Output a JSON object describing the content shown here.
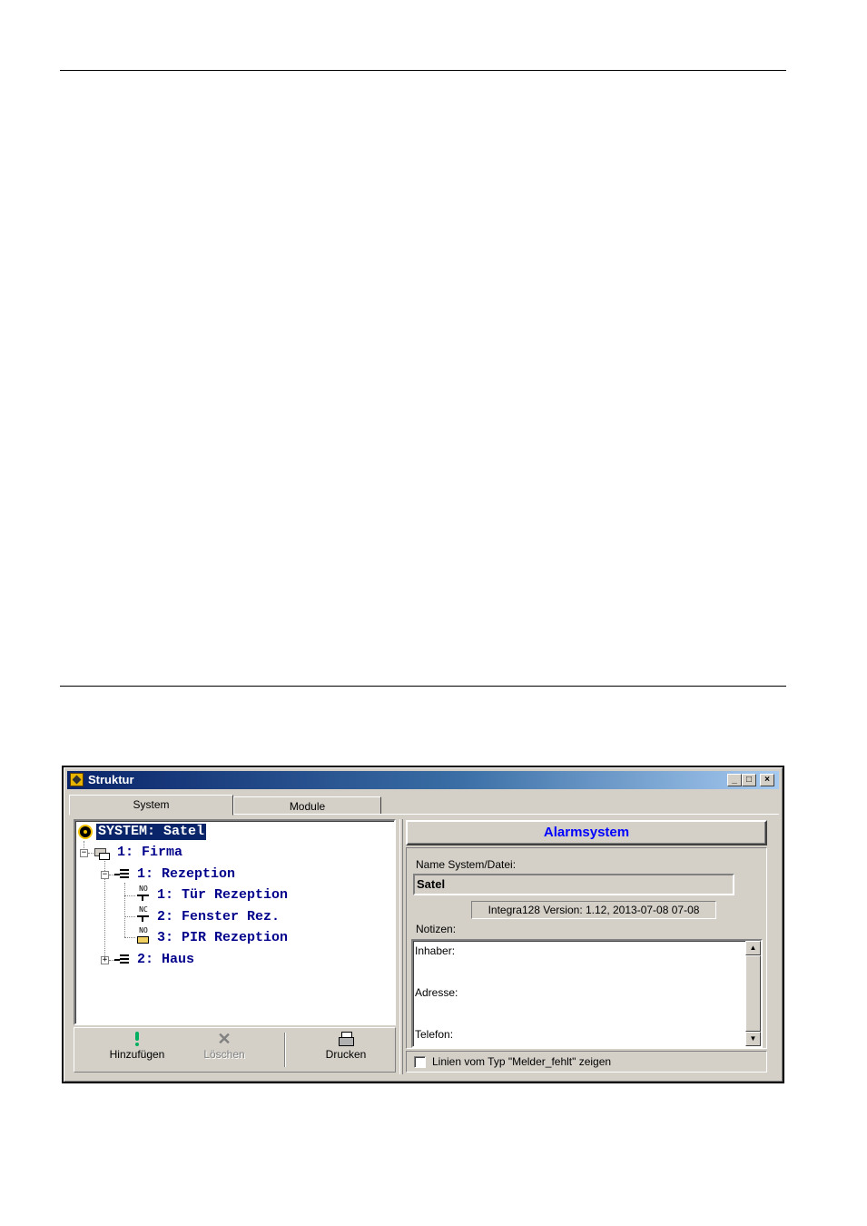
{
  "window": {
    "title": "Struktur"
  },
  "controls": {
    "minimize": "_",
    "maximize": "□",
    "close": "×"
  },
  "tabs": [
    {
      "label": "System",
      "active": true
    },
    {
      "label": "Module",
      "active": false
    }
  ],
  "tree": {
    "root": {
      "label": "SYSTEM: Satel",
      "icon": "system-icon"
    },
    "nodes": [
      {
        "label": "1: Firma",
        "icon": "object-icon",
        "expander": "−"
      },
      {
        "label": "1: Rezeption",
        "icon": "partition-icon",
        "expander": "−"
      },
      {
        "label": "1: Tür Rezeption",
        "icon": "zone-no-icon",
        "tag": "NO"
      },
      {
        "label": "2: Fenster Rez.",
        "icon": "zone-nc-icon",
        "tag": "NC"
      },
      {
        "label": "3: PIR Rezeption",
        "icon": "zone-pir-icon",
        "tag": "NO"
      },
      {
        "label": "2: Haus",
        "icon": "partition-icon",
        "expander": "+"
      }
    ]
  },
  "toolbar": {
    "add_label": "Hinzufügen",
    "delete_label": "Löschen",
    "print_label": "Drucken"
  },
  "panel": {
    "header": "Alarmsystem",
    "name_label": "Name System/Datei:",
    "name_value": "Satel",
    "version": "Integra128  Version: 1.12,   2013-07-08 07-08",
    "notes_label": "Notizen:",
    "notes_lines": [
      "Inhaber:",
      "Adresse:",
      "Telefon:"
    ],
    "checkbox_label": "Linien vom Typ \"Melder_fehlt\" zeigen",
    "checkbox_checked": false
  },
  "colors": {
    "tree_text": "#00008b",
    "selection": "#0a246a",
    "header_text": "#0000ff",
    "face": "#d4d0c8"
  }
}
